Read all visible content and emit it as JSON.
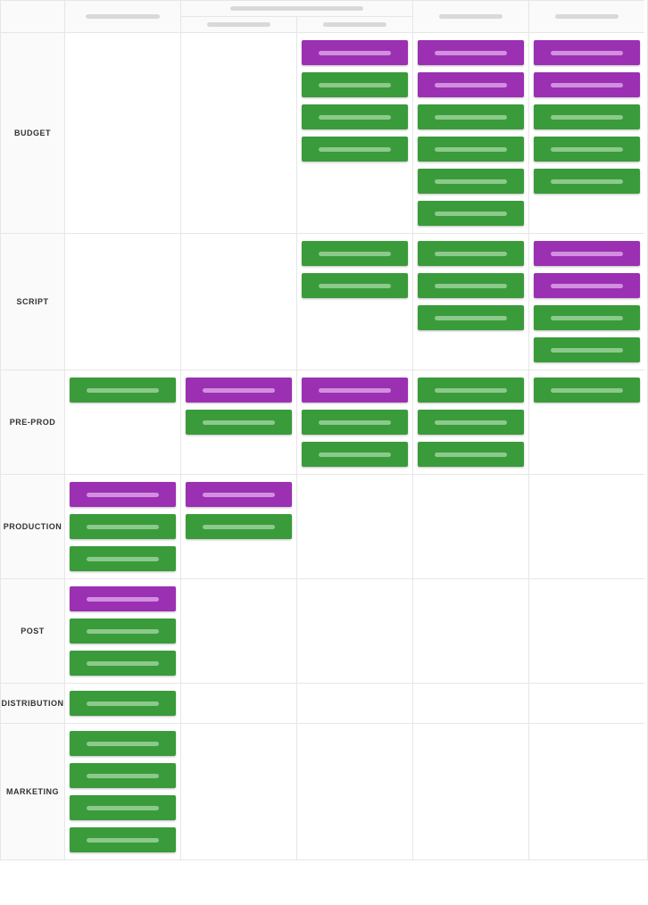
{
  "columns": [
    "",
    "",
    "",
    "",
    "",
    ""
  ],
  "rows": [
    {
      "label": "BUDGET",
      "cells": [
        [],
        [],
        [
          "purple",
          "green",
          "green",
          "green"
        ],
        [
          "purple",
          "purple",
          "green",
          "green",
          "green",
          "green"
        ],
        [
          "purple",
          "purple",
          "green",
          "green",
          "green"
        ]
      ]
    },
    {
      "label": "SCRIPT",
      "cells": [
        [],
        [],
        [
          "green",
          "green"
        ],
        [
          "green",
          "green",
          "green"
        ],
        [
          "purple",
          "purple",
          "green",
          "green"
        ]
      ]
    },
    {
      "label": "PRE-PROD",
      "cells": [
        [
          "green"
        ],
        [
          "purple",
          "green"
        ],
        [
          "purple",
          "green",
          "green"
        ],
        [
          "green",
          "green",
          "green"
        ],
        [
          "green"
        ]
      ]
    },
    {
      "label": "PRODUCTION",
      "cells": [
        [
          "purple",
          "green",
          "green"
        ],
        [
          "purple",
          "green"
        ],
        [],
        [],
        []
      ]
    },
    {
      "label": "POST",
      "cells": [
        [
          "purple",
          "green",
          "green"
        ],
        [],
        [],
        [],
        []
      ]
    },
    {
      "label": "DISTRIBUTION",
      "cells": [
        [
          "green"
        ],
        [],
        [],
        [],
        []
      ]
    },
    {
      "label": "MARKETING",
      "cells": [
        [
          "green",
          "green",
          "green",
          "green"
        ],
        [],
        [],
        [],
        []
      ]
    }
  ]
}
